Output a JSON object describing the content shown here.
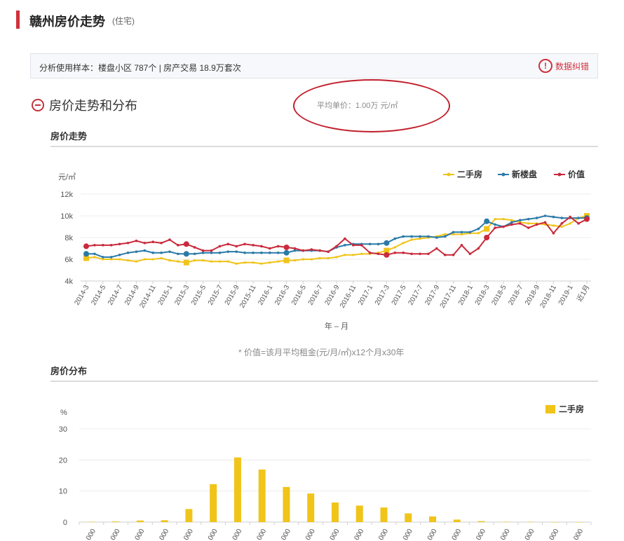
{
  "header": {
    "title": "赣州房价走势",
    "subtitle": "(住宅)"
  },
  "info": {
    "text": "分析使用样本：楼盘小区 787个   |  房产交易 18.9万套次",
    "correction_label": "数据纠错"
  },
  "section": {
    "title": "房价走势和分布",
    "average": "平均单价：1.00万 元/㎡"
  },
  "trend_heading": "房价走势",
  "dist_heading": "房价分布",
  "note": "* 价值=该月平均租金(元/月/㎡)x12个月x30年",
  "colors": {
    "secondhand": "#f0c419",
    "newbuild": "#2a7aa8",
    "value": "#c92a3c",
    "accent": "#d0313c"
  },
  "chart_data": [
    {
      "type": "line",
      "ylabel": "元/㎡",
      "xlabel": "年 – 月",
      "ylim": [
        4000,
        12000
      ],
      "yticks": [
        {
          "v": 4000,
          "t": "4k"
        },
        {
          "v": 6000,
          "t": "6k"
        },
        {
          "v": 8000,
          "t": "8k"
        },
        {
          "v": 10000,
          "t": "10k"
        },
        {
          "v": 12000,
          "t": "12k"
        }
      ],
      "x": [
        "2014-3",
        "2014-4",
        "2014-5",
        "2014-6",
        "2014-7",
        "2014-8",
        "2014-9",
        "2014-10",
        "2014-11",
        "2014-12",
        "2015-1",
        "2015-2",
        "2015-3",
        "2015-4",
        "2015-5",
        "2015-6",
        "2015-7",
        "2015-8",
        "2015-9",
        "2015-10",
        "2015-11",
        "2015-12",
        "2016-1",
        "2016-2",
        "2016-3",
        "2016-4",
        "2016-5",
        "2016-6",
        "2016-7",
        "2016-8",
        "2016-9",
        "2016-10",
        "2016-11",
        "2016-12",
        "2017-1",
        "2017-2",
        "2017-3",
        "2017-4",
        "2017-5",
        "2017-6",
        "2017-7",
        "2017-8",
        "2017-9",
        "2017-10",
        "2017-11",
        "2017-12",
        "2018-1",
        "2018-2",
        "2018-3",
        "2018-4",
        "2018-5",
        "2018-6",
        "2018-7",
        "2018-8",
        "2018-9",
        "2018-10",
        "2018-11",
        "2018-12",
        "2019-1",
        "2019-2",
        "近1月"
      ],
      "xtick_labels": [
        "2014-3",
        "2014-5",
        "2014-7",
        "2014-9",
        "2014-11",
        "2015-1",
        "2015-3",
        "2015-5",
        "2015-7",
        "2015-9",
        "2015-11",
        "2016-1",
        "2016-3",
        "2016-5",
        "2016-7",
        "2016-9",
        "2016-11",
        "2017-1",
        "2017-3",
        "2017-5",
        "2017-7",
        "2017-9",
        "2017-11",
        "2018-1",
        "2018-3",
        "2018-5",
        "2018-7",
        "2018-9",
        "2018-11",
        "2019-1",
        "近1月"
      ],
      "legend_position": "top-right",
      "series": [
        {
          "name": "二手房",
          "color": "#f0c419",
          "values": [
            6100,
            6200,
            6000,
            6000,
            6000,
            5900,
            5800,
            6000,
            6000,
            6100,
            5900,
            5800,
            5700,
            5900,
            5900,
            5800,
            5800,
            5800,
            5600,
            5700,
            5700,
            5600,
            5700,
            5800,
            5900,
            5900,
            6000,
            6000,
            6100,
            6100,
            6200,
            6400,
            6400,
            6500,
            6500,
            6600,
            6800,
            7100,
            7500,
            7800,
            7900,
            8000,
            8100,
            8300,
            8300,
            8300,
            8400,
            8400,
            8800,
            9700,
            9700,
            9600,
            9400,
            9300,
            9300,
            9200,
            9100,
            9000,
            9300,
            9800,
            10000
          ],
          "markers": [
            0,
            12,
            24,
            36,
            48,
            60
          ]
        },
        {
          "name": "新楼盘",
          "color": "#2a7aa8",
          "values": [
            6500,
            6500,
            6200,
            6200,
            6400,
            6600,
            6700,
            6800,
            6600,
            6600,
            6700,
            6500,
            6500,
            6500,
            6600,
            6600,
            6600,
            6700,
            6700,
            6600,
            6600,
            6600,
            6600,
            6600,
            6600,
            6800,
            6800,
            6800,
            6800,
            6700,
            7100,
            7300,
            7400,
            7400,
            7400,
            7400,
            7500,
            7900,
            8100,
            8100,
            8100,
            8100,
            8000,
            8100,
            8500,
            8500,
            8500,
            8800,
            9500,
            9200,
            9000,
            9400,
            9600,
            9700,
            9800,
            10000,
            9900,
            9800,
            9800,
            9800,
            9800
          ],
          "markers": [
            0,
            12,
            24,
            36,
            48,
            60
          ]
        },
        {
          "name": "价值",
          "color": "#c92a3c",
          "values": [
            7200,
            7300,
            7300,
            7300,
            7400,
            7500,
            7700,
            7500,
            7600,
            7500,
            7800,
            7300,
            7400,
            7100,
            6800,
            6800,
            7200,
            7400,
            7200,
            7400,
            7300,
            7200,
            7000,
            7200,
            7100,
            7000,
            6800,
            6900,
            6800,
            6700,
            7200,
            7900,
            7300,
            7300,
            6600,
            6500,
            6400,
            6600,
            6600,
            6500,
            6500,
            6500,
            7000,
            6400,
            6400,
            7300,
            6500,
            7000,
            8000,
            8900,
            9000,
            9200,
            9300,
            8900,
            9200,
            9400,
            8400,
            9300,
            9900,
            9300,
            9700
          ],
          "markers": [
            0,
            12,
            24,
            36,
            48,
            60
          ]
        }
      ]
    },
    {
      "type": "bar",
      "ylabel": "%",
      "ylim": [
        0,
        30
      ],
      "yticks": [
        0,
        10,
        20,
        30
      ],
      "legend_position": "top-right",
      "categories": [
        "1",
        "2",
        "3",
        "4",
        "5",
        "6",
        "7",
        "8",
        "9",
        "10",
        "11",
        "12",
        "13",
        "14",
        "15",
        "16",
        "17",
        "18",
        "19",
        "20",
        "21"
      ],
      "xtick_label": "000",
      "series": [
        {
          "name": "二手房",
          "color": "#f0c419",
          "values": [
            0.1,
            0.2,
            0.5,
            0.6,
            4.2,
            12.2,
            20.8,
            16.9,
            11.3,
            9.2,
            6.3,
            5.3,
            4.7,
            2.8,
            1.8,
            0.8,
            0.3,
            0.1,
            0.1,
            0,
            0
          ]
        }
      ]
    }
  ]
}
